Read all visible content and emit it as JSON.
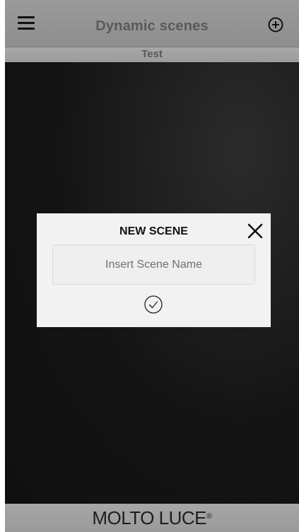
{
  "header": {
    "title": "Dynamic scenes",
    "menu_icon": "hamburger-menu-icon",
    "add_icon": "plus-circle-icon"
  },
  "subheader": {
    "title": "Test"
  },
  "dialog": {
    "title": "NEW SCENE",
    "input_placeholder": "Insert Scene Name",
    "input_value": "",
    "close_icon": "close-x-icon",
    "confirm_icon": "check-circle-icon"
  },
  "footer": {
    "brand": "MOLTO LUCE",
    "brand_mark": "®"
  },
  "colors": {
    "header_bg": "#939393",
    "content_bg": "#121212",
    "dialog_bg": "#f2f2f2",
    "title_text": "#5a5a5a"
  }
}
